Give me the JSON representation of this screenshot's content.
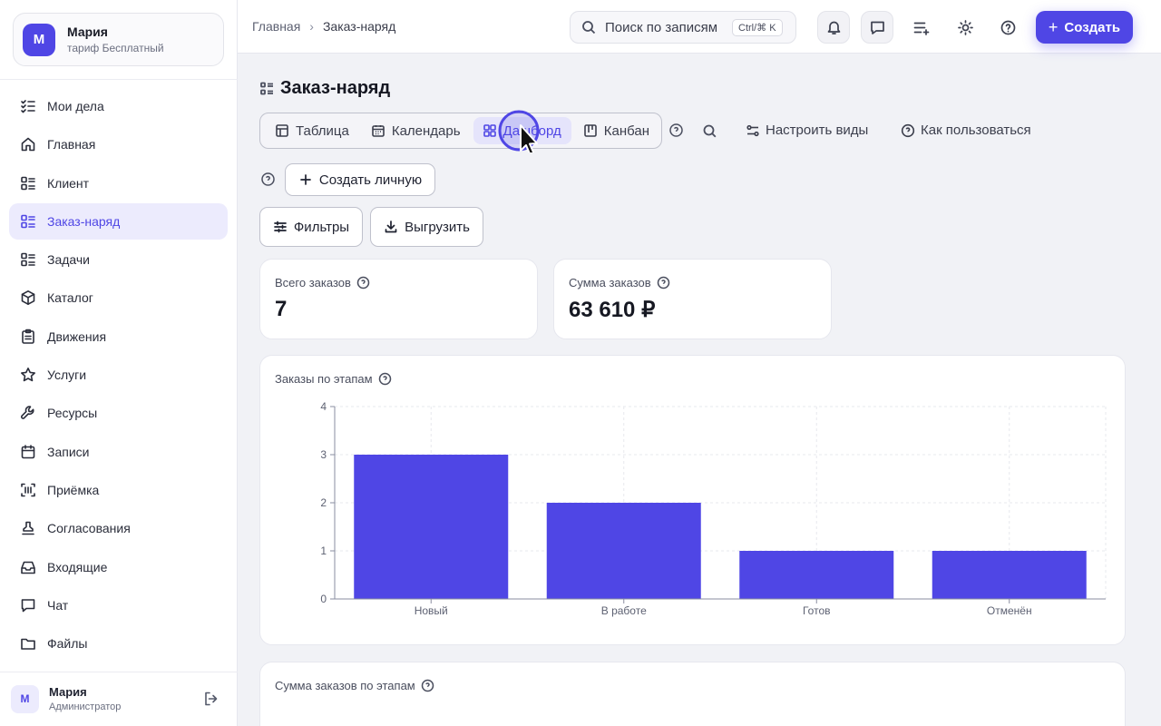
{
  "profile": {
    "initial": "М",
    "name": "Мария",
    "plan": "тариф Бесплатный"
  },
  "nav": [
    {
      "label": "Мои дела",
      "icon": "checklist-icon"
    },
    {
      "label": "Главная",
      "icon": "home-icon"
    },
    {
      "label": "Клиент",
      "icon": "list-icon"
    },
    {
      "label": "Заказ-наряд",
      "icon": "list-icon",
      "active": true
    },
    {
      "label": "Задачи",
      "icon": "list-icon"
    },
    {
      "label": "Каталог",
      "icon": "box-icon"
    },
    {
      "label": "Движения",
      "icon": "clipboard-icon"
    },
    {
      "label": "Услуги",
      "icon": "star-icon"
    },
    {
      "label": "Ресурсы",
      "icon": "wrench-icon"
    },
    {
      "label": "Записи",
      "icon": "calendar-icon"
    },
    {
      "label": "Приёмка",
      "icon": "scan-icon"
    },
    {
      "label": "Согласования",
      "icon": "stamp-icon"
    },
    {
      "label": "Входящие",
      "icon": "inbox-icon"
    },
    {
      "label": "Чат",
      "icon": "chat-icon"
    },
    {
      "label": "Файлы",
      "icon": "folder-icon"
    }
  ],
  "user": {
    "initial": "М",
    "name": "Мария",
    "role": "Администратор"
  },
  "breadcrumb": {
    "home": "Главная",
    "separator": "›",
    "current": "Заказ-наряд"
  },
  "search": {
    "placeholder": "Поиск по записям",
    "shortcut": "Ctrl/⌘ K"
  },
  "topbar": {
    "create_label": "Создать"
  },
  "page": {
    "title": "Заказ-наряд"
  },
  "views": [
    {
      "label": "Таблица",
      "icon": "table-icon"
    },
    {
      "label": "Календарь",
      "icon": "calendar-icon"
    },
    {
      "label": "Дашборд",
      "icon": "dashboard-icon",
      "active": true
    },
    {
      "label": "Канбан",
      "icon": "kanban-icon"
    }
  ],
  "actions": {
    "configure_views": "Настроить виды",
    "how_to_use": "Как пользоваться",
    "create_personal": "Создать личную",
    "filters": "Фильтры",
    "export": "Выгрузить"
  },
  "kpis": {
    "total_orders": {
      "label": "Всего заказов",
      "value": "7"
    },
    "orders_sum": {
      "label": "Сумма заказов",
      "value": "63 610 ₽"
    }
  },
  "chart1": {
    "title": "Заказы по этапам"
  },
  "chart2": {
    "title": "Сумма заказов по этапам"
  },
  "colors": {
    "accent": "#4f46e5",
    "accent_soft": "#ecebfd"
  },
  "chart_data": {
    "type": "bar",
    "categories": [
      "Новый",
      "В работе",
      "Готов",
      "Отменён"
    ],
    "values": [
      3,
      2,
      1,
      1
    ],
    "ylim": [
      0,
      4
    ],
    "yticks": [
      0,
      1,
      2,
      3,
      4
    ],
    "grid": true,
    "title": "Заказы по этапам"
  }
}
